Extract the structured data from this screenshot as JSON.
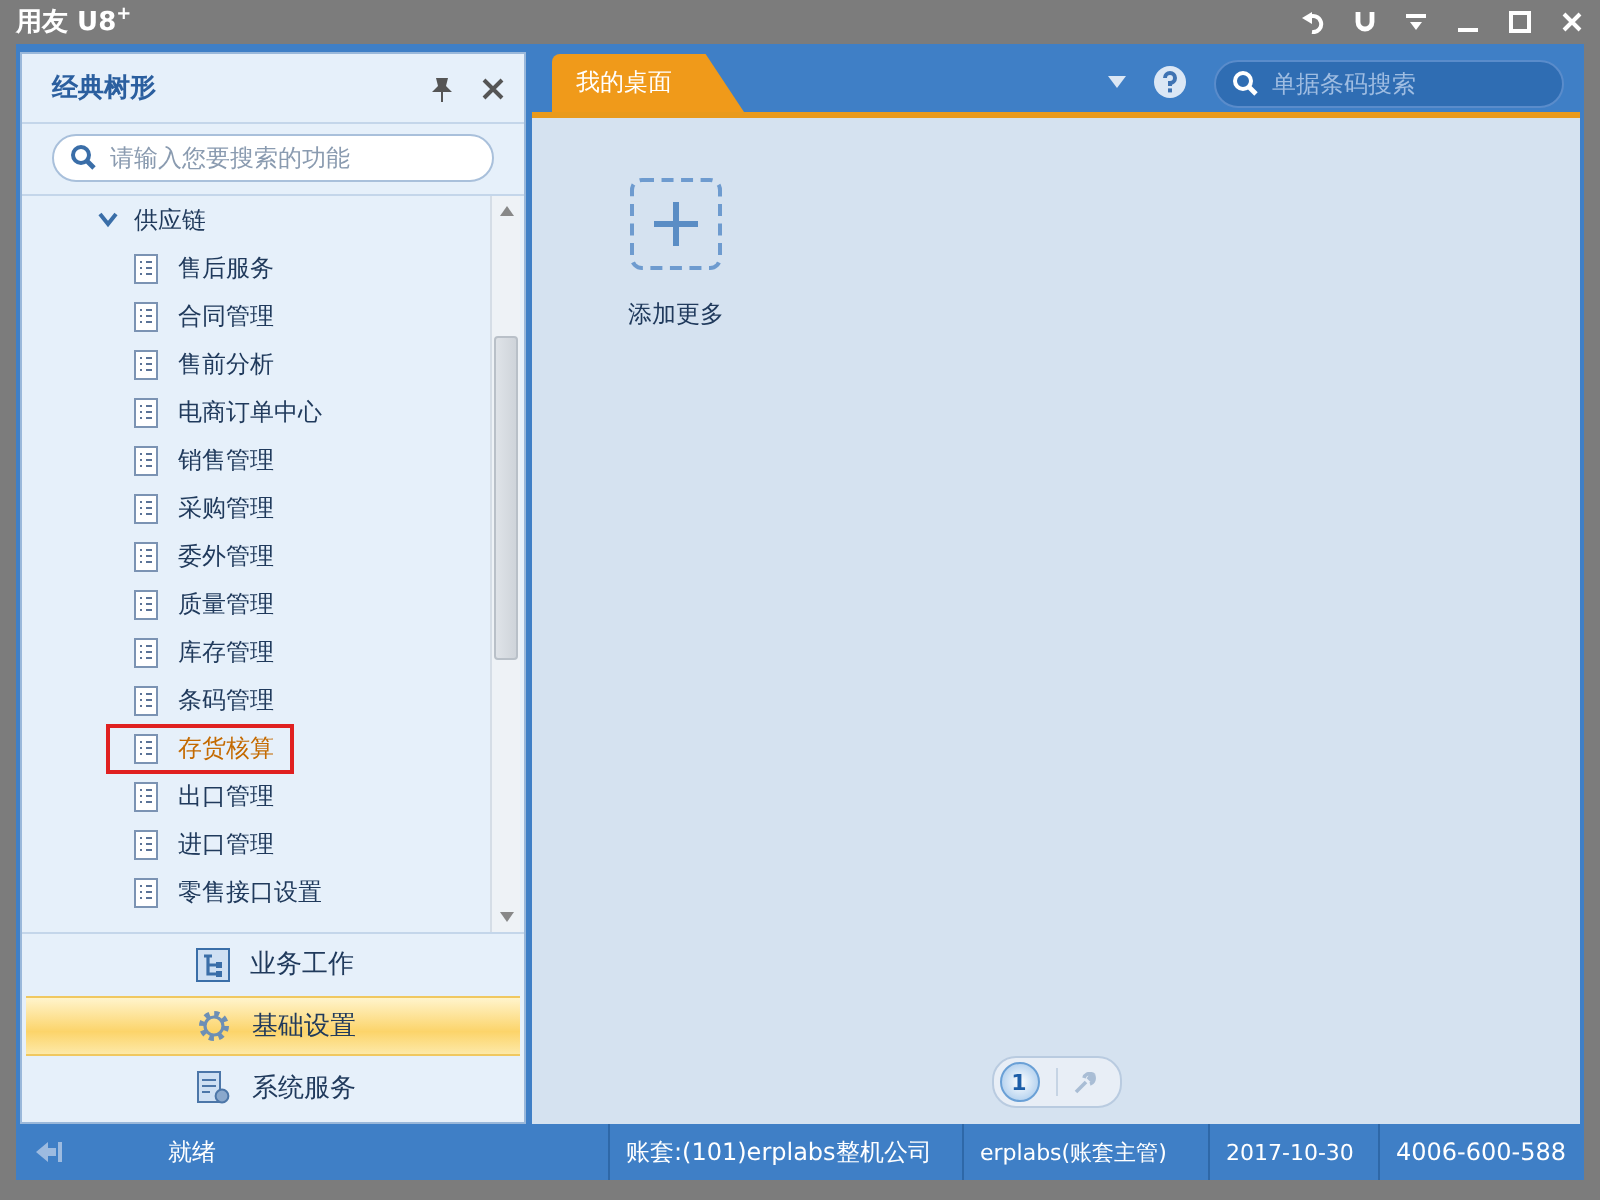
{
  "window": {
    "title": "用友 U8",
    "title_sup": "+"
  },
  "left_panel": {
    "title": "经典树形",
    "search": {
      "placeholder": "请输入您要搜索的功能"
    },
    "tree": [
      {
        "label": "供应链",
        "expanded": true,
        "children": [
          {
            "label": "售后服务",
            "selected": false
          },
          {
            "label": "合同管理",
            "selected": false
          },
          {
            "label": "售前分析",
            "selected": false
          },
          {
            "label": "电商订单中心",
            "selected": false
          },
          {
            "label": "销售管理",
            "selected": false
          },
          {
            "label": "采购管理",
            "selected": false
          },
          {
            "label": "委外管理",
            "selected": false
          },
          {
            "label": "质量管理",
            "selected": false
          },
          {
            "label": "库存管理",
            "selected": false
          },
          {
            "label": "条码管理",
            "selected": false
          },
          {
            "label": "存货核算",
            "selected": true
          },
          {
            "label": "出口管理",
            "selected": false
          },
          {
            "label": "进口管理",
            "selected": false
          },
          {
            "label": "零售接口设置",
            "selected": false
          }
        ]
      }
    ],
    "nav": [
      {
        "label": "业务工作",
        "kind": "tree",
        "selected": false
      },
      {
        "label": "基础设置",
        "kind": "gear",
        "selected": true
      },
      {
        "label": "系统服务",
        "kind": "service",
        "selected": false
      }
    ]
  },
  "tabs": [
    {
      "label": "我的桌面",
      "selected": true
    }
  ],
  "top_search": {
    "placeholder": "单据条码搜索"
  },
  "desktop": {
    "add_label": "添加更多",
    "pager": [
      {
        "label": "1",
        "selected": true
      }
    ]
  },
  "status_bar": {
    "state": "就绪",
    "account": "账套:(101)erplabs整机公司",
    "user": "erplabs(账套主管)",
    "date": "2017-10-30",
    "phone": "4006-600-588"
  }
}
